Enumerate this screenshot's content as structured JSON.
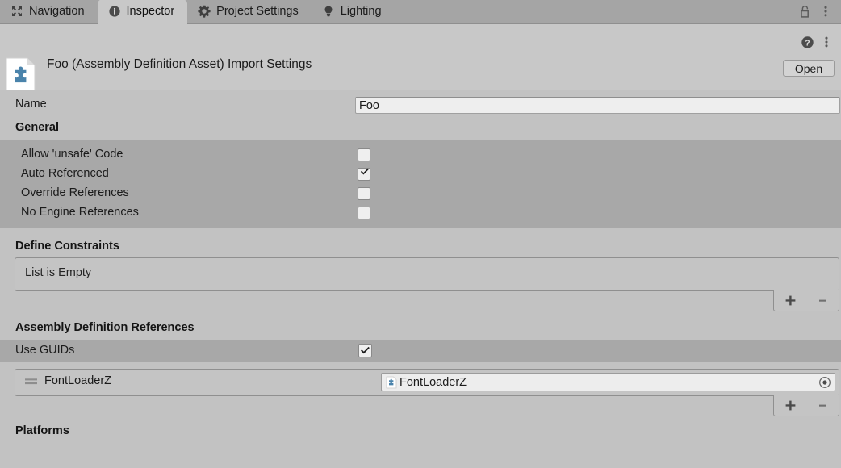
{
  "tabbar": {
    "tabs": [
      {
        "label": "Navigation",
        "icon": "navigation-icon",
        "active": false
      },
      {
        "label": "Inspector",
        "icon": "info-icon",
        "active": true
      },
      {
        "label": "Project Settings",
        "icon": "gear-icon",
        "active": false
      },
      {
        "label": "Lighting",
        "icon": "lightbulb-icon",
        "active": false
      }
    ],
    "lock_icon": "padlock-open-icon",
    "menu_icon": "kebab-menu-icon"
  },
  "asset_header": {
    "icon": "assembly-definition-asset-icon",
    "title": "Foo (Assembly Definition Asset) Import Settings",
    "help_icon": "help-icon",
    "menu_icon": "kebab-menu-icon",
    "open_label": "Open"
  },
  "inspector": {
    "name_label": "Name",
    "name_value": "Foo",
    "general_header": "General",
    "general_options": [
      {
        "label": "Allow 'unsafe' Code",
        "checked": false
      },
      {
        "label": "Auto Referenced",
        "checked": true
      },
      {
        "label": "Override References",
        "checked": false
      },
      {
        "label": "No Engine References",
        "checked": false
      }
    ],
    "define_constraints": {
      "header": "Define Constraints",
      "empty_text": "List is Empty",
      "add_label": "+",
      "remove_label": "−"
    },
    "assembly_references": {
      "header": "Assembly Definition References",
      "use_guids_label": "Use GUIDs",
      "use_guids_checked": true,
      "rows": [
        {
          "drag_handle": "drag-handle-icon",
          "name": "FontLoaderZ",
          "object_value": "FontLoaderZ",
          "object_icon": "assembly-definition-asset-icon",
          "picker_icon": "object-picker-icon"
        }
      ],
      "add_label": "+",
      "remove_label": "−"
    },
    "platforms_header": "Platforms"
  },
  "colors": {
    "window_background": "#c2c2c2",
    "tabbar_background": "#a5a5a5",
    "active_tab_background": "#c8c8c8",
    "section_background": "#a8a8a8",
    "field_background": "#eeeeee",
    "accent_blue": "#4a83ab",
    "text": "#1b1b1b"
  }
}
